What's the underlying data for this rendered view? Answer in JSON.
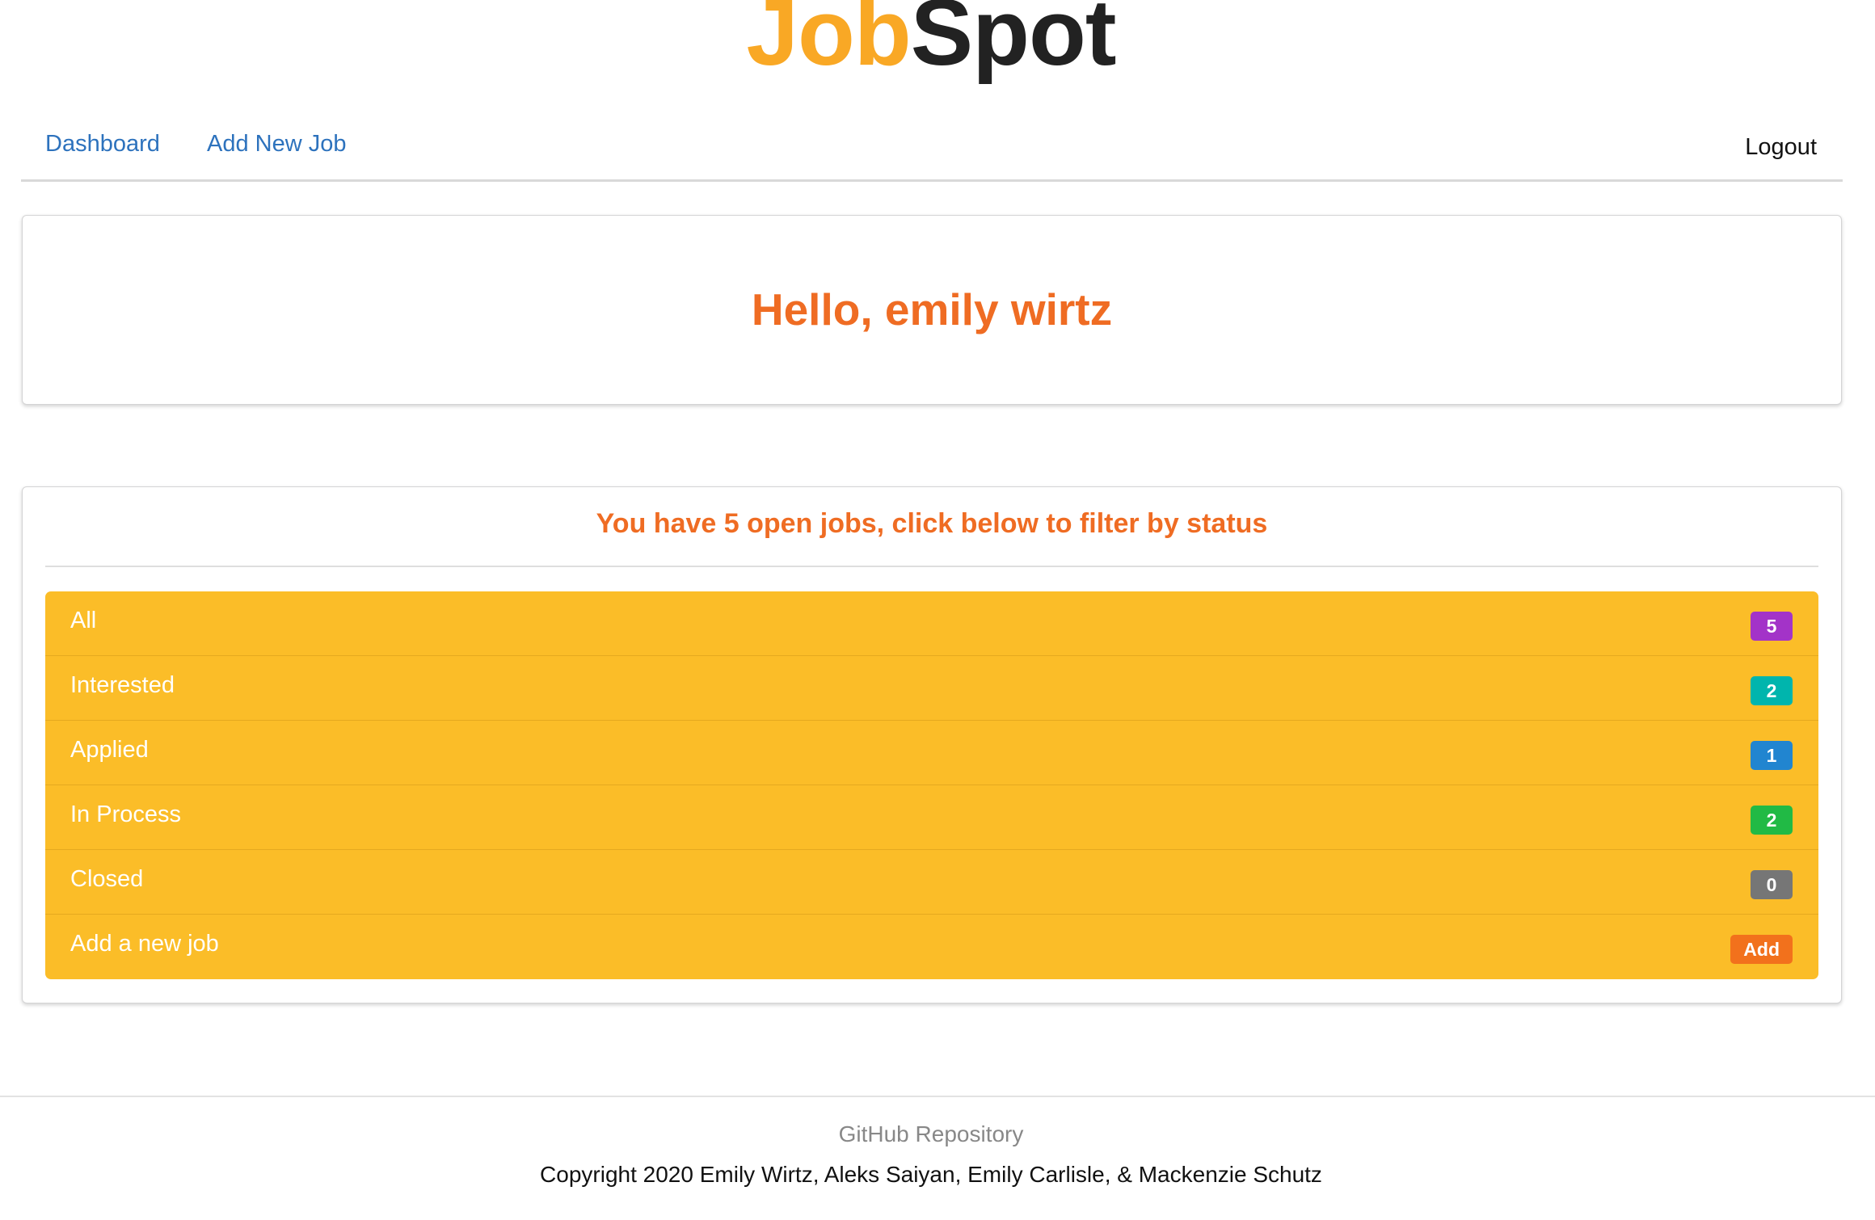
{
  "logo": {
    "part1": "Job",
    "part2": "Spot",
    "color_part1": "#f9a825",
    "color_part2": "#222222"
  },
  "nav": {
    "dashboard_label": "Dashboard",
    "add_job_label": "Add New Job",
    "logout_label": "Logout",
    "link_color": "#2d72bd"
  },
  "hello": {
    "greeting": "Hello, emily wirtz",
    "color": "#ef6c23"
  },
  "jobs": {
    "heading": "You have 5 open jobs, click below to filter by status",
    "list_color": "#fbbd28",
    "items": [
      {
        "label": "All",
        "badge": "5",
        "badge_color": "#a333c8"
      },
      {
        "label": "Interested",
        "badge": "2",
        "badge_color": "#00b5ad"
      },
      {
        "label": "Applied",
        "badge": "1",
        "badge_color": "#2185d0"
      },
      {
        "label": "In Process",
        "badge": "2",
        "badge_color": "#21ba45"
      },
      {
        "label": "Closed",
        "badge": "0",
        "badge_color": "#767676"
      },
      {
        "label": "Add a new job",
        "badge": "Add",
        "badge_color": "#f2711c"
      }
    ]
  },
  "footer": {
    "github_label": "GitHub Repository",
    "copyright": "Copyright 2020 Emily Wirtz, Aleks Saiyan, Emily Carlisle, & Mackenzie Schutz"
  }
}
